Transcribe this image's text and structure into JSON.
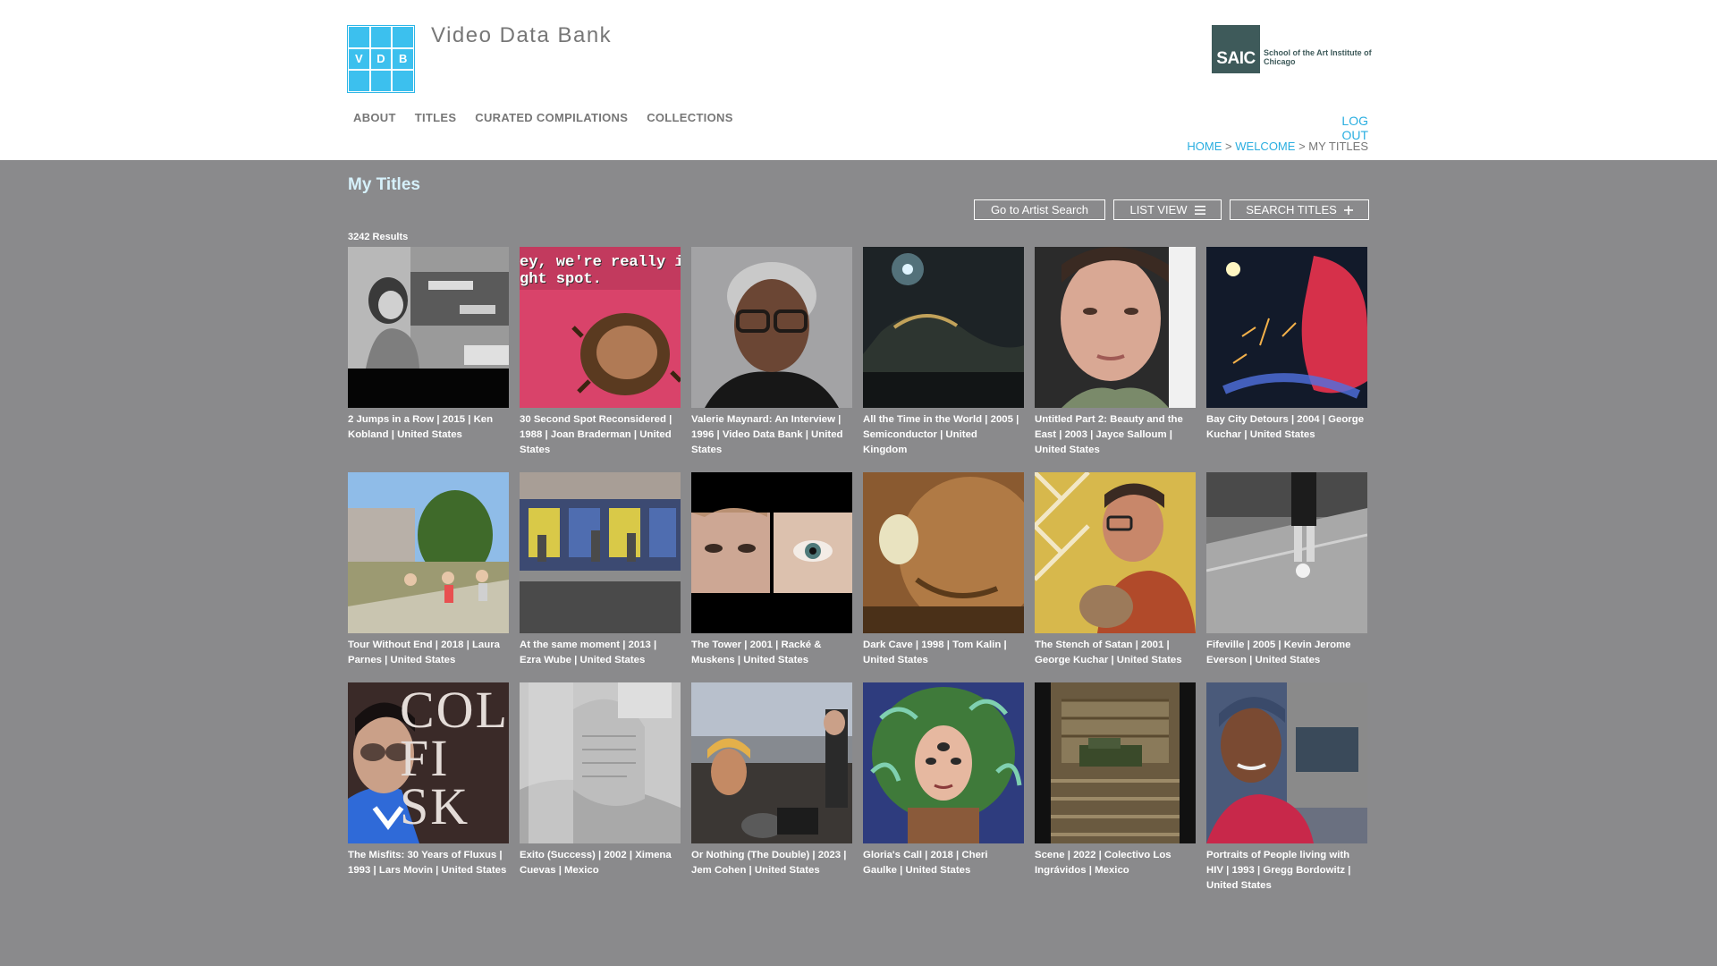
{
  "site": {
    "logo_letters": [
      "V",
      "D",
      "B"
    ],
    "title": "Video Data Bank",
    "partner_logo_abbr": "SAIC",
    "partner_logo_name": "School of the Art Institute of Chicago"
  },
  "nav": {
    "items": [
      {
        "label": "ABOUT"
      },
      {
        "label": "TITLES"
      },
      {
        "label": "CURATED COMPILATIONS"
      },
      {
        "label": "COLLECTIONS"
      }
    ],
    "logout": "LOG OUT"
  },
  "breadcrumb": {
    "home": "HOME",
    "welcome": "WELCOME",
    "current": "MY TITLES",
    "separator": ">"
  },
  "page": {
    "title": "My Titles",
    "results_count": "3242 Results"
  },
  "toolbar": {
    "artist_search": "Go to Artist Search",
    "list_view": "LIST VIEW",
    "list_view_icon": "hamburger-icon",
    "search_titles": "SEARCH TITLES",
    "search_titles_icon": "plus-icon"
  },
  "colors": {
    "accent": "#2aaee0",
    "page_bg": "#8a8a8c",
    "title": "#d6f1fb",
    "saic": "#3e5a5a"
  },
  "titles": [
    {
      "caption": "2 Jumps in a Row | 2015 | Ken Kobland | United States"
    },
    {
      "caption": "30 Second Spot Reconsidered | 1988 | Joan Braderman | United States",
      "thumb_text": "ey, we're really in\nght spot."
    },
    {
      "caption": "Valerie Maynard: An Interview | 1996 | Video Data Bank | United States"
    },
    {
      "caption": "All the Time in the World | 2005 | Semiconductor | United Kingdom"
    },
    {
      "caption": "Untitled Part 2: Beauty and the East | 2003 | Jayce Salloum | United States"
    },
    {
      "caption": "Bay City Detours | 2004 | George Kuchar | United States"
    },
    {
      "caption": "Tour Without End | 2018 | Laura Parnes | United States"
    },
    {
      "caption": "At the same moment | 2013 | Ezra Wube | United States"
    },
    {
      "caption": "The Tower | 2001 | Racké & Muskens | United States"
    },
    {
      "caption": "Dark Cave | 1998 | Tom Kalin | United States"
    },
    {
      "caption": "The Stench of Satan | 2001 | George Kuchar | United States"
    },
    {
      "caption": "Fifeville | 2005 | Kevin Jerome Everson | United States"
    },
    {
      "caption": "The Misfits: 30 Years of Fluxus | 1993 | Lars Movin | United States",
      "thumb_text": "COLOR\nFI\nSK"
    },
    {
      "caption": "Exito (Success) | 2002 | Ximena Cuevas | Mexico"
    },
    {
      "caption": "Or Nothing (The Double) | 2023 | Jem Cohen | United States"
    },
    {
      "caption": "Gloria's Call | 2018 | Cheri Gaulke | United States"
    },
    {
      "caption": "Scene | 2022 | Colectivo Los Ingrávidos | Mexico"
    },
    {
      "caption": "Portraits of People living with HIV | 1993 | Gregg Bordowitz | United States"
    }
  ]
}
